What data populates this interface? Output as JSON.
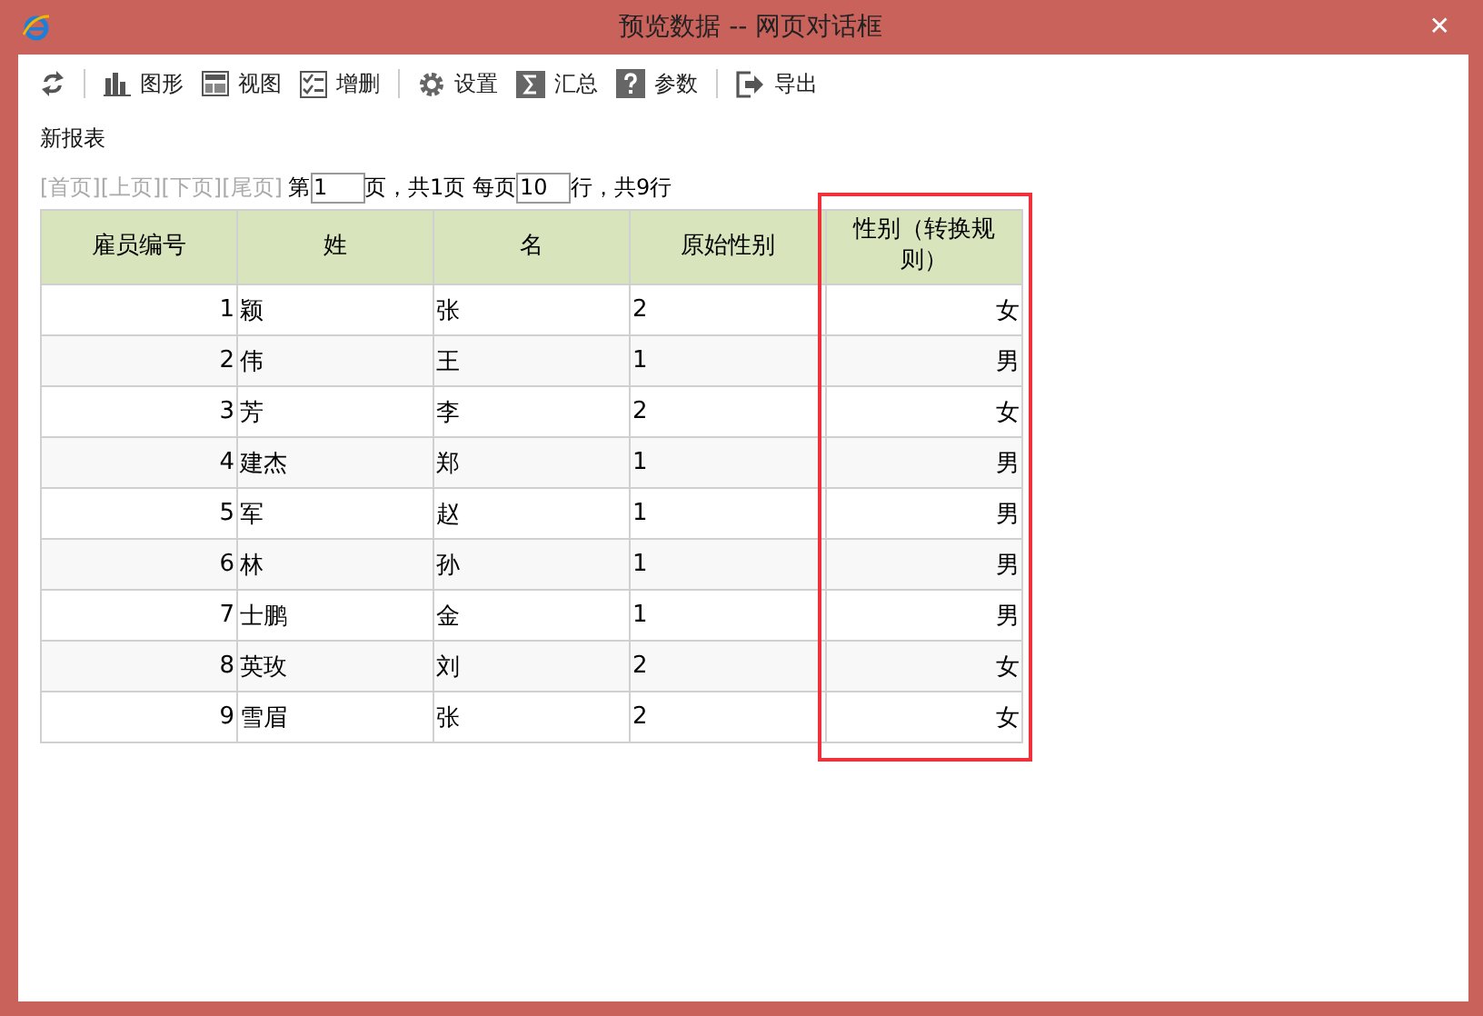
{
  "window": {
    "title": "预览数据 -- 网页对话框",
    "close": "✕"
  },
  "toolbar": [
    {
      "kind": "refresh"
    },
    {
      "kind": "chart",
      "label": "图形"
    },
    {
      "kind": "view",
      "label": "视图"
    },
    {
      "kind": "edit",
      "label": "增删"
    },
    {
      "kind": "settings",
      "label": "设置"
    },
    {
      "kind": "sum",
      "label": "汇总"
    },
    {
      "kind": "param",
      "label": "参数"
    },
    {
      "kind": "export",
      "label": "导出"
    }
  ],
  "report_title": "新报表",
  "pager": {
    "links": [
      {
        "label": "[首页]",
        "disabled": true
      },
      {
        "label": "[上页]",
        "disabled": true
      },
      {
        "label": "[下页]",
        "disabled": true
      },
      {
        "label": "[尾页]",
        "disabled": true
      }
    ],
    "page_prefix": "第",
    "page_value": "1",
    "page_suffix": "页，共1页 每页",
    "per_page_value": "10",
    "rows_suffix": "行，共9行"
  },
  "table": {
    "columns": [
      {
        "label": "雇员编号",
        "highlighted": false
      },
      {
        "label": "姓",
        "highlighted": false
      },
      {
        "label": "名",
        "highlighted": false
      },
      {
        "label": "原始性别",
        "highlighted": false
      },
      {
        "label": "性别（转换规则）",
        "highlighted": true
      }
    ],
    "rows": [
      [
        "1",
        "颖",
        "张",
        "2",
        "女"
      ],
      [
        "2",
        "伟",
        "王",
        "1",
        "男"
      ],
      [
        "3",
        "芳",
        "李",
        "2",
        "女"
      ],
      [
        "4",
        "建杰",
        "郑",
        "1",
        "男"
      ],
      [
        "5",
        "军",
        "赵",
        "1",
        "男"
      ],
      [
        "6",
        "林",
        "孙",
        "1",
        "男"
      ],
      [
        "7",
        "士鹏",
        "金",
        "1",
        "男"
      ],
      [
        "8",
        "英玫",
        "刘",
        "2",
        "女"
      ],
      [
        "9",
        "雪眉",
        "张",
        "2",
        "女"
      ]
    ]
  }
}
